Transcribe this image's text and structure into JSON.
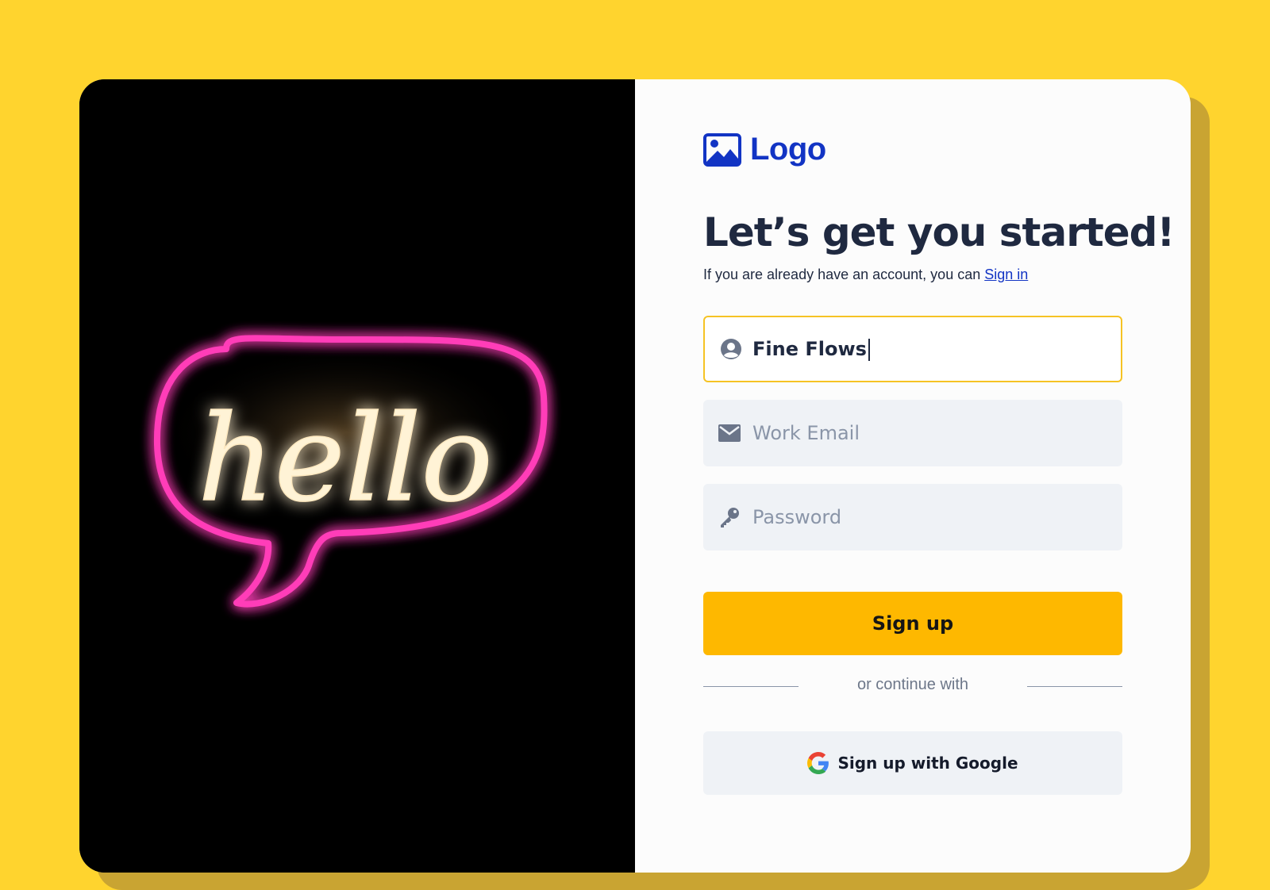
{
  "colors": {
    "background": "#FFD42E",
    "brand": "#1234C4",
    "primary_button": "#FEB800",
    "active_border": "#F6C324",
    "neon_pink": "#FF3DB8",
    "neon_warm": "#FFF3D6"
  },
  "hero": {
    "image_description_icon": "hello-neon-sign-icon",
    "image_text": "hello"
  },
  "logo": {
    "text": "Logo",
    "icon": "image-icon"
  },
  "header": {
    "title": "Let’s get you started!",
    "subtitle_prefix": "If you are already have an account, you can ",
    "signin_link": "Sign in"
  },
  "form": {
    "name": {
      "value": "Fine Flows",
      "icon": "user-circle-icon"
    },
    "email": {
      "placeholder": "Work Email",
      "icon": "mail-icon"
    },
    "password": {
      "placeholder": "Password",
      "icon": "key-icon"
    },
    "submit_label": "Sign up",
    "divider_text": "or continue with",
    "google_label": "Sign up with Google",
    "google_icon": "google-icon"
  }
}
